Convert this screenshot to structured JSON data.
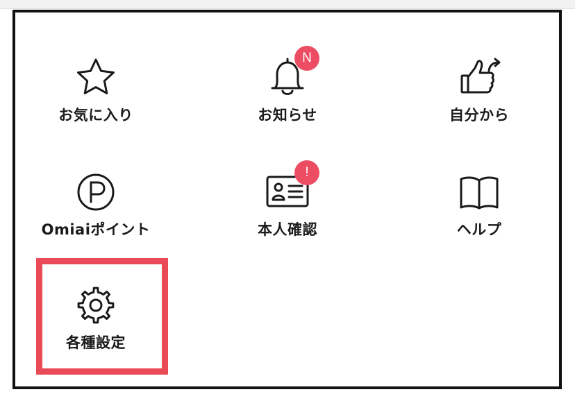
{
  "menu": {
    "items": [
      {
        "label": "お気に入り",
        "icon": "star-icon"
      },
      {
        "label": "お知らせ",
        "icon": "bell-icon",
        "badge": "N"
      },
      {
        "label": "自分から",
        "icon": "thumbs-up-share-icon"
      },
      {
        "label": "Omiaiポイント",
        "icon": "points-p-icon"
      },
      {
        "label": "本人確認",
        "icon": "id-card-icon",
        "badge": "!"
      },
      {
        "label": "ヘルプ",
        "icon": "book-icon"
      },
      {
        "label": "各種設定",
        "icon": "gear-icon",
        "highlighted": true
      }
    ]
  },
  "colors": {
    "badge": "#ec4d63",
    "highlight": "#ea4a55",
    "frame": "#111111",
    "text": "#1a1a1a"
  }
}
